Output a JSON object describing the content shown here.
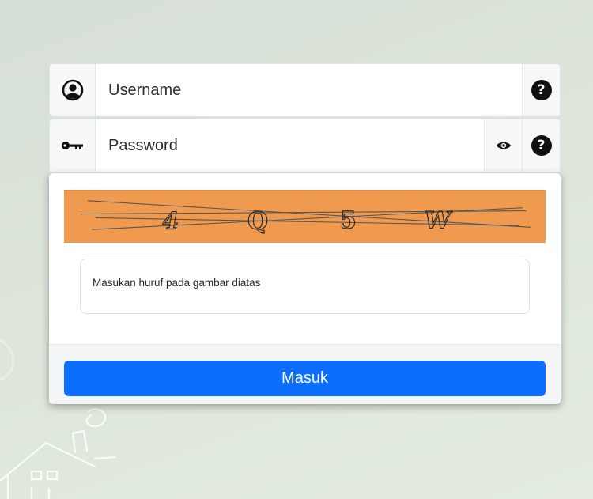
{
  "login_form": {
    "username": {
      "placeholder": "Username",
      "icon": "user-circle-icon",
      "help": "?"
    },
    "password": {
      "placeholder": "Password",
      "icon": "key-icon",
      "toggle_icon": "eye-icon",
      "help": "?"
    }
  },
  "captcha": {
    "characters": [
      "4",
      "Q",
      "5",
      "W"
    ],
    "background_color": "#f09a4f",
    "input_placeholder": "Masukan huruf pada gambar diatas"
  },
  "submit": {
    "label": "Masuk",
    "color": "#0d6efd"
  }
}
